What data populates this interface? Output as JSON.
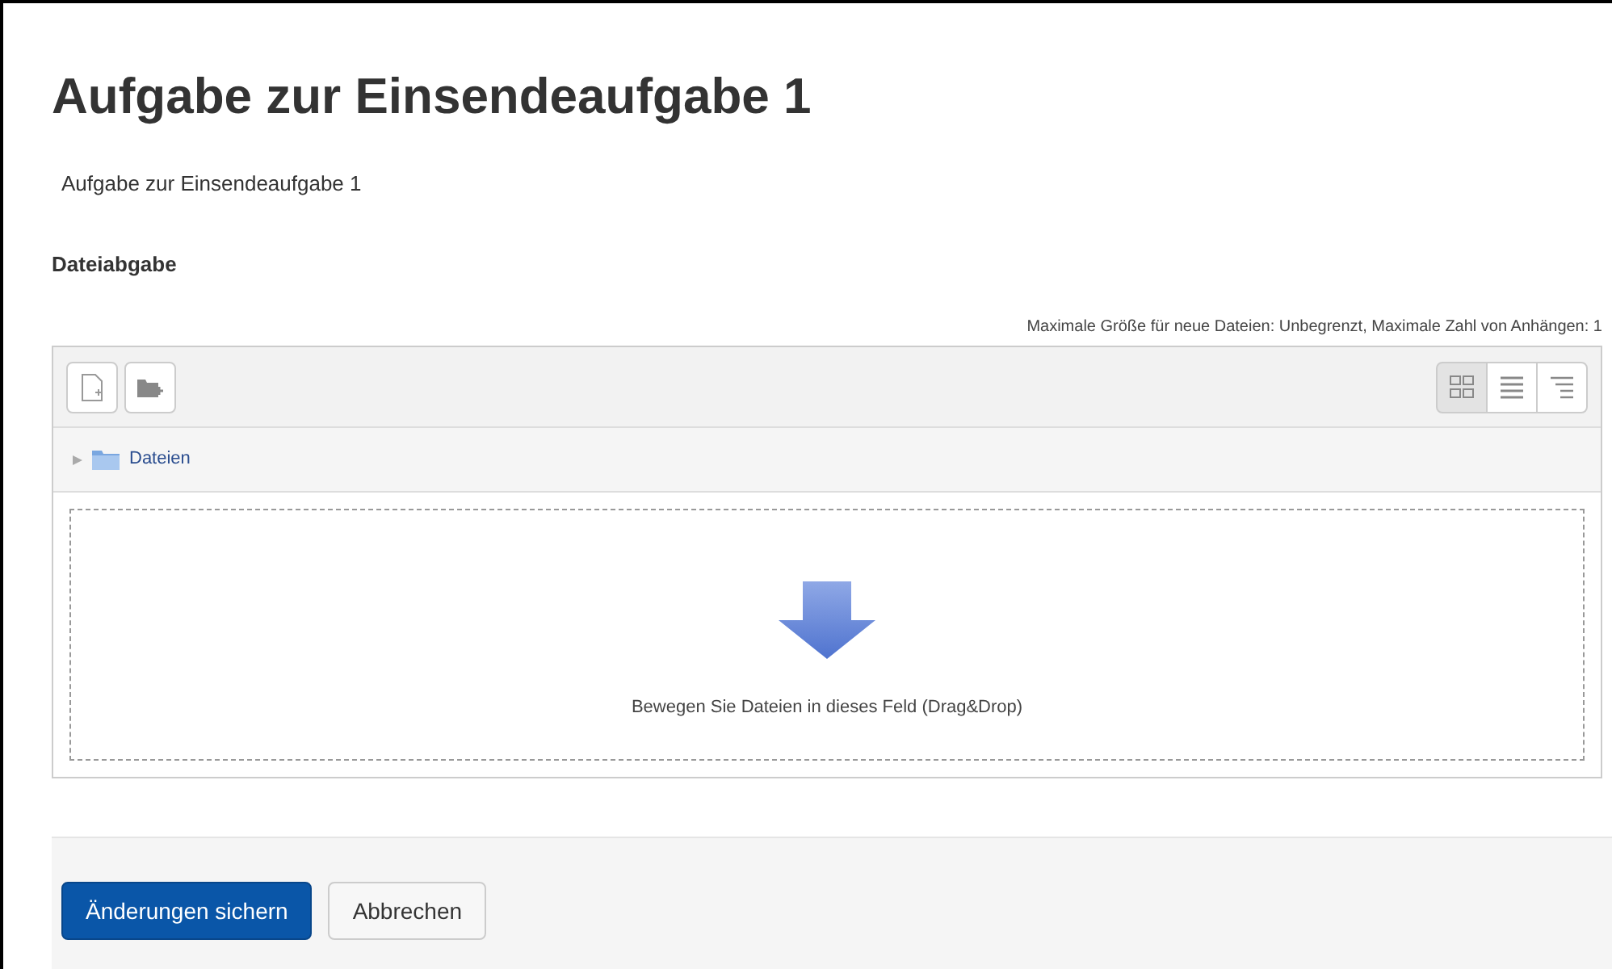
{
  "title": "Aufgabe zur Einsendeaufgabe 1",
  "description": "Aufgabe zur Einsendeaufgabe 1",
  "section_label": "Dateiabgabe",
  "limits": "Maximale Größe für neue Dateien: Unbegrenzt, Maximale Zahl von Anhängen: 1",
  "view_modes": [
    {
      "kind": "icons",
      "selected": true
    },
    {
      "kind": "list",
      "selected": false
    },
    {
      "kind": "tree",
      "selected": false
    }
  ],
  "folder": {
    "label": "Dateien",
    "expanded": false
  },
  "dropzone_text": "Bewegen Sie Dateien in dieses Feld (Drag&Drop)",
  "buttons": [
    {
      "label": "Änderungen sichern",
      "kind": "primary"
    },
    {
      "label": "Abbrechen",
      "kind": "secondary"
    }
  ]
}
